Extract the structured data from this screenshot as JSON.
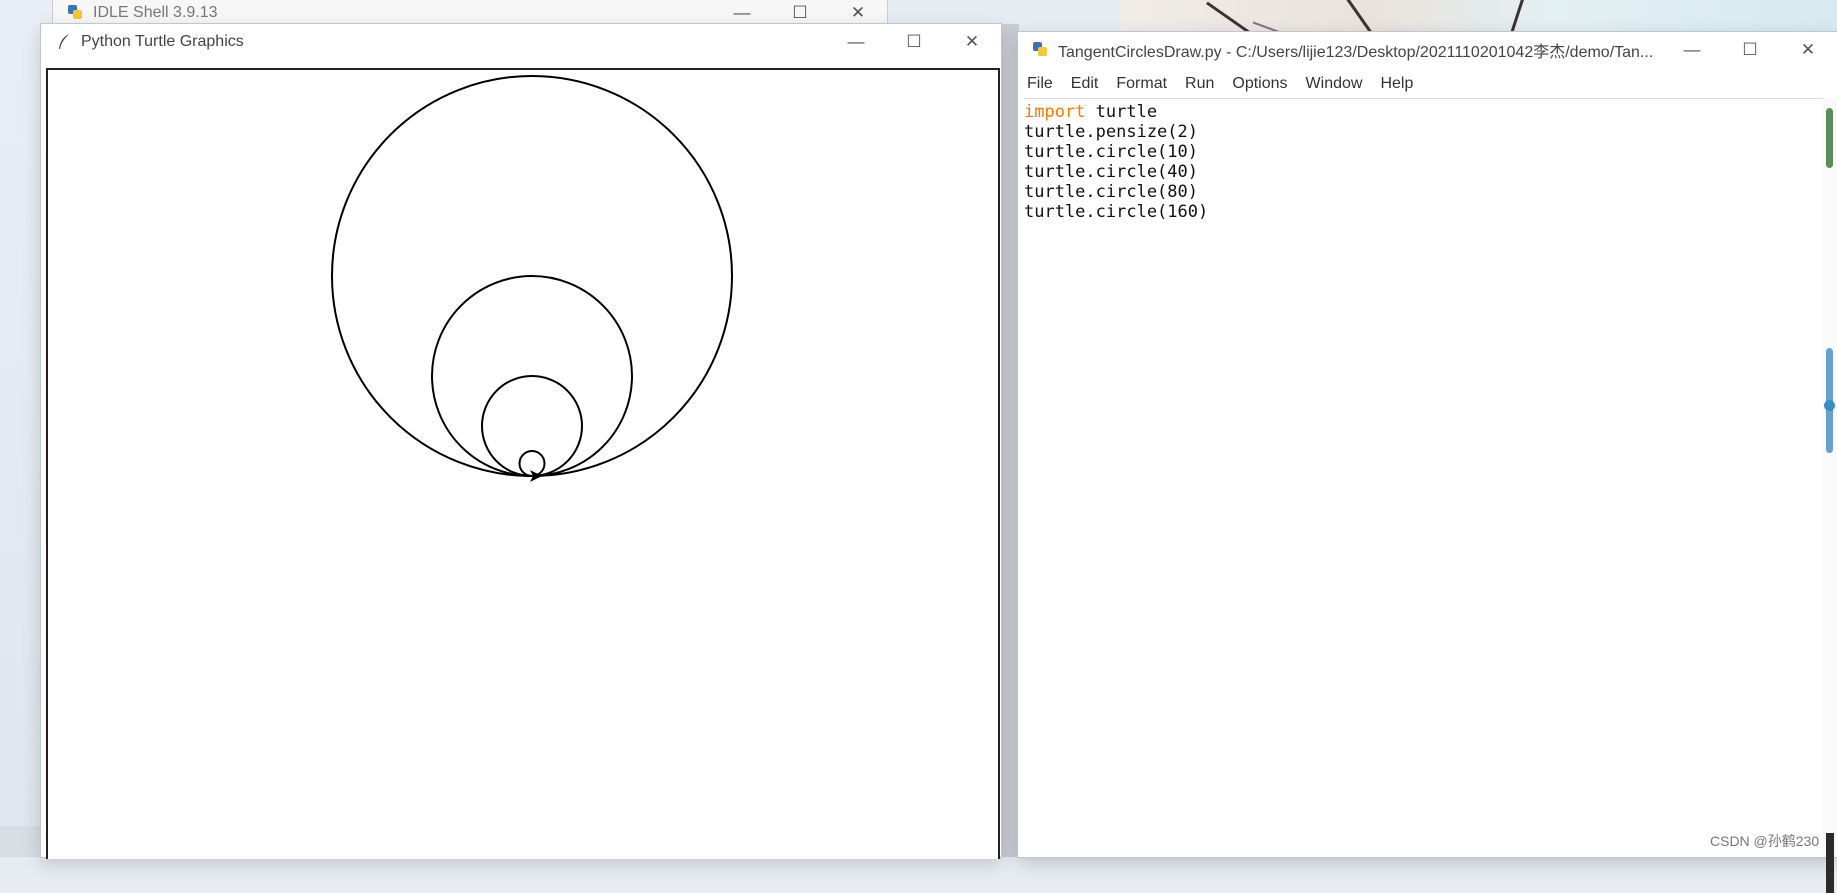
{
  "shell_window": {
    "title": "IDLE Shell 3.9.13"
  },
  "turtle_window": {
    "title": "Python Turtle Graphics",
    "pensize": 2,
    "circles": [
      10,
      40,
      80,
      160
    ]
  },
  "editor_window": {
    "title": "TangentCirclesDraw.py - C:/Users/lijie123/Desktop/2021110201042李杰/demo/Tan...",
    "menu": [
      "File",
      "Edit",
      "Format",
      "Run",
      "Options",
      "Window",
      "Help"
    ],
    "code": [
      {
        "kw": "import",
        "rest": " turtle"
      },
      {
        "kw": "",
        "rest": "turtle.pensize(2)"
      },
      {
        "kw": "",
        "rest": "turtle.circle(10)"
      },
      {
        "kw": "",
        "rest": "turtle.circle(40)"
      },
      {
        "kw": "",
        "rest": "turtle.circle(80)"
      },
      {
        "kw": "",
        "rest": "turtle.circle(160)"
      }
    ]
  },
  "caption_buttons": {
    "minimize": "—",
    "maximize": "☐",
    "close": "✕"
  },
  "watermark": "CSDN @孙鹤230"
}
